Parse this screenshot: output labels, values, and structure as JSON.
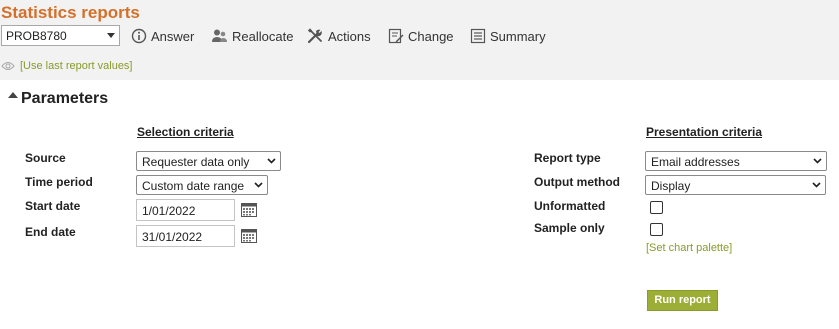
{
  "header": {
    "title": "Statistics reports",
    "problem_select": {
      "value": "PROB8780"
    },
    "toolbar": [
      {
        "id": "answer",
        "label": "Answer",
        "icon": "info-circle-icon"
      },
      {
        "id": "reallocate",
        "label": "Reallocate",
        "icon": "users-icon"
      },
      {
        "id": "actions",
        "label": "Actions",
        "icon": "tools-icon"
      },
      {
        "id": "change",
        "label": "Change",
        "icon": "edit-icon"
      },
      {
        "id": "summary",
        "label": "Summary",
        "icon": "list-icon"
      }
    ],
    "last_report_link": "[Use last report values]"
  },
  "parameters": {
    "heading": "Parameters",
    "selection": {
      "heading": "Selection criteria",
      "source": {
        "label": "Source",
        "value": "Requester data only"
      },
      "time_period": {
        "label": "Time period",
        "value": "Custom date range"
      },
      "start_date": {
        "label": "Start date",
        "value": "1/01/2022"
      },
      "end_date": {
        "label": "End date",
        "value": "31/01/2022"
      }
    },
    "presentation": {
      "heading": "Presentation criteria",
      "report_type": {
        "label": "Report type",
        "value": "Email addresses"
      },
      "output_method": {
        "label": "Output method",
        "value": "Display"
      },
      "unformatted": {
        "label": "Unformatted",
        "checked": false
      },
      "sample_only": {
        "label": "Sample only",
        "checked": false
      },
      "chart_palette_link": "[Set chart palette]"
    },
    "run_button": "Run report"
  },
  "colors": {
    "title": "#d4702a",
    "link": "#8a9a2a",
    "run_button": "#9cae35",
    "topbar_bg": "#f2f2f2"
  }
}
